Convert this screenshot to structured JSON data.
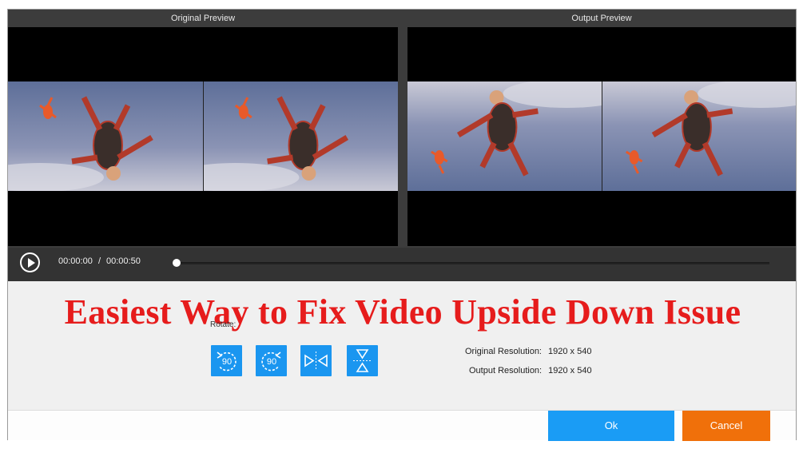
{
  "previews": {
    "original_title": "Original Preview",
    "output_title": "Output Preview"
  },
  "player": {
    "current_time": "00:00:00",
    "separator": "/",
    "total_time": "00:00:50",
    "progress_fraction": 0.0
  },
  "overlay": {
    "headline": "Easiest Way to Fix Video Upside Down Issue"
  },
  "rotate": {
    "label": "Rotate:",
    "buttons": [
      {
        "icon": "rotate-left-90-icon",
        "text": "90"
      },
      {
        "icon": "rotate-right-90-icon",
        "text": "90"
      },
      {
        "icon": "flip-horizontal-icon",
        "text": ""
      },
      {
        "icon": "flip-vertical-icon",
        "text": ""
      }
    ]
  },
  "resolution": {
    "original_label": "Original Resolution:",
    "original_value": "1920 x 540",
    "output_label": "Output Resolution:",
    "output_value": "1920 x 540"
  },
  "footer": {
    "ok_label": "Ok",
    "cancel_label": "Cancel"
  },
  "colors": {
    "accent_blue": "#1a96f0",
    "cancel_orange": "#f0700a",
    "headline_red": "#e61c1c"
  }
}
